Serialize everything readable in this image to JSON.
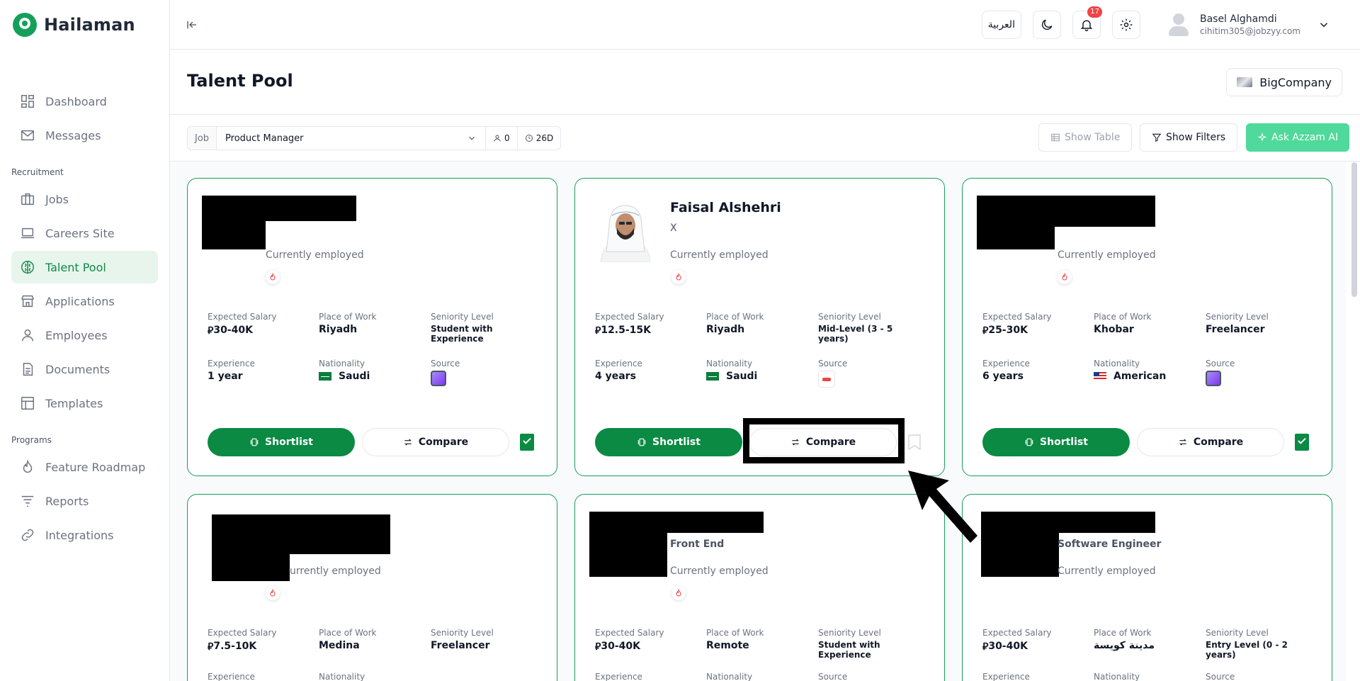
{
  "app": {
    "name": "Hailaman"
  },
  "sidebar": {
    "items_main": [
      {
        "label": "Dashboard",
        "icon": "dashboard-icon"
      },
      {
        "label": "Messages",
        "icon": "mail-icon"
      }
    ],
    "section_recruitment": "Recruitment",
    "items_recruitment": [
      {
        "label": "Jobs",
        "icon": "briefcase-icon"
      },
      {
        "label": "Careers Site",
        "icon": "laptop-icon"
      },
      {
        "label": "Talent Pool",
        "icon": "brain-icon",
        "active": true
      },
      {
        "label": "Applications",
        "icon": "store-icon"
      },
      {
        "label": "Employees",
        "icon": "user-icon"
      },
      {
        "label": "Documents",
        "icon": "document-icon"
      },
      {
        "label": "Templates",
        "icon": "layout-icon"
      }
    ],
    "section_programs": "Programs",
    "items_programs": [
      {
        "label": "Feature Roadmap",
        "icon": "flame-icon"
      },
      {
        "label": "Reports",
        "icon": "filter-lines-icon"
      },
      {
        "label": "Integrations",
        "icon": "link-icon"
      }
    ]
  },
  "header": {
    "language_label": "العربية",
    "notification_count": "17",
    "user_name": "Basel Alghamdi",
    "user_email": "cihitim305@jobzyy.com"
  },
  "page": {
    "title": "Talent Pool",
    "company": "BigCompany"
  },
  "filter_bar": {
    "job_label": "Job",
    "job_value": "Product Manager",
    "candidates_count": "0",
    "days": "26D",
    "show_table": "Show Table",
    "show_filters": "Show Filters",
    "ask_ai": "Ask Azzam AI"
  },
  "labels": {
    "expected_salary": "Expected Salary",
    "place_of_work": "Place of Work",
    "seniority_level": "Seniority Level",
    "experience": "Experience",
    "nationality": "Nationality",
    "source": "Source",
    "shortlist": "Shortlist",
    "compare": "Compare"
  },
  "cards": [
    {
      "name": "",
      "title": "",
      "status": "Currently employed",
      "salary": "30-40K",
      "place": "Riyadh",
      "seniority": "Student with Experience",
      "experience": "1 year",
      "nationality": "Saudi"
    },
    {
      "name": "Faisal Alshehri",
      "title": "X",
      "status": "Currently employed",
      "salary": "12.5-15K",
      "place": "Riyadh",
      "seniority": "Mid-Level (3 - 5 years)",
      "experience": "4 years",
      "nationality": "Saudi"
    },
    {
      "name": "",
      "title": "",
      "status": "Currently employed",
      "salary": "25-30K",
      "place": "Khobar",
      "seniority": "Freelancer",
      "experience": "6 years",
      "nationality": "American"
    },
    {
      "name": "",
      "title": "",
      "status": "urrently employed",
      "salary": "7.5-10K",
      "place": "Medina",
      "seniority": "Freelancer",
      "experience": "Experience",
      "nationality": "Nationality"
    },
    {
      "name": "",
      "title": "Front End",
      "status": "Currently employed",
      "salary": "30-40K",
      "place": "Remote",
      "seniority": "Student with Experience",
      "experience": "",
      "nationality": ""
    },
    {
      "name": "",
      "title": "Software Engineer",
      "status": "Currently employed",
      "salary": "30-40K",
      "place": "مدينة كويسة",
      "seniority": "Entry Level (0 - 2 years)",
      "experience": "",
      "nationality": ""
    }
  ],
  "currency_symbol": "⃁",
  "colors": {
    "brand": "#0a8a43",
    "accent_ai": "#4fd99a",
    "active_bg": "#e7f5ec"
  }
}
